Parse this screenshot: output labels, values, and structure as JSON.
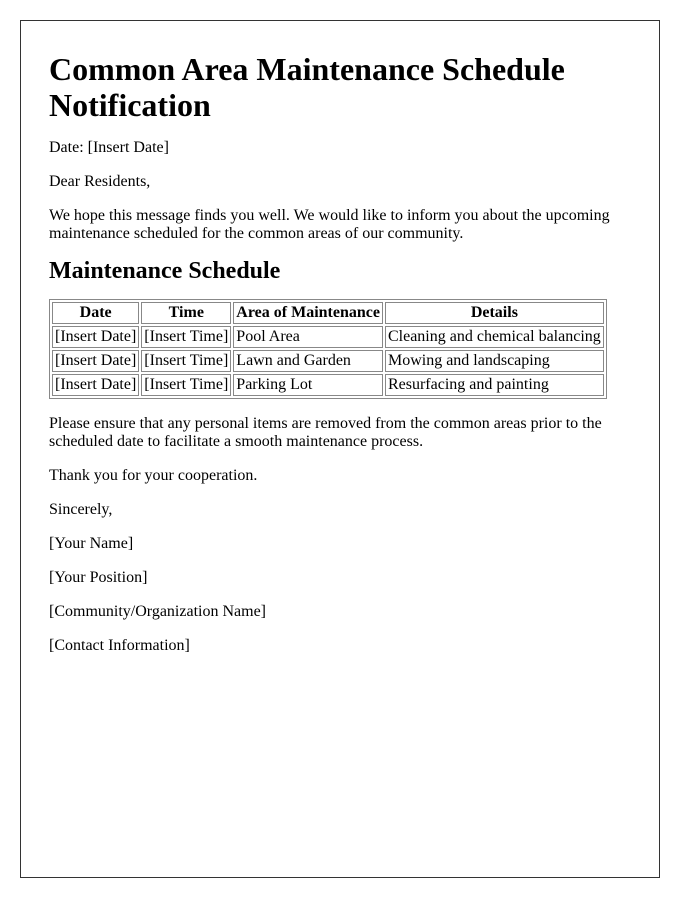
{
  "document": {
    "title": "Common Area Maintenance Schedule Notification",
    "date_line": "Date: [Insert Date]",
    "greeting": "Dear Residents,",
    "intro": "We hope this message finds you well. We would like to inform you about the upcoming maintenance scheduled for the common areas of our community.",
    "section_heading": "Maintenance Schedule",
    "table": {
      "headers": [
        "Date",
        "Time",
        "Area of Maintenance",
        "Details"
      ],
      "rows": [
        [
          "[Insert Date]",
          "[Insert Time]",
          "Pool Area",
          "Cleaning and chemical balancing"
        ],
        [
          "[Insert Date]",
          "[Insert Time]",
          "Lawn and Garden",
          "Mowing and landscaping"
        ],
        [
          "[Insert Date]",
          "[Insert Time]",
          "Parking Lot",
          "Resurfacing and painting"
        ]
      ]
    },
    "instructions": "Please ensure that any personal items are removed from the common areas prior to the scheduled date to facilitate a smooth maintenance process.",
    "thanks": "Thank you for your cooperation.",
    "closing": "Sincerely,",
    "signature": {
      "name": "[Your Name]",
      "position": "[Your Position]",
      "organization": "[Community/Organization Name]",
      "contact": "[Contact Information]"
    }
  }
}
